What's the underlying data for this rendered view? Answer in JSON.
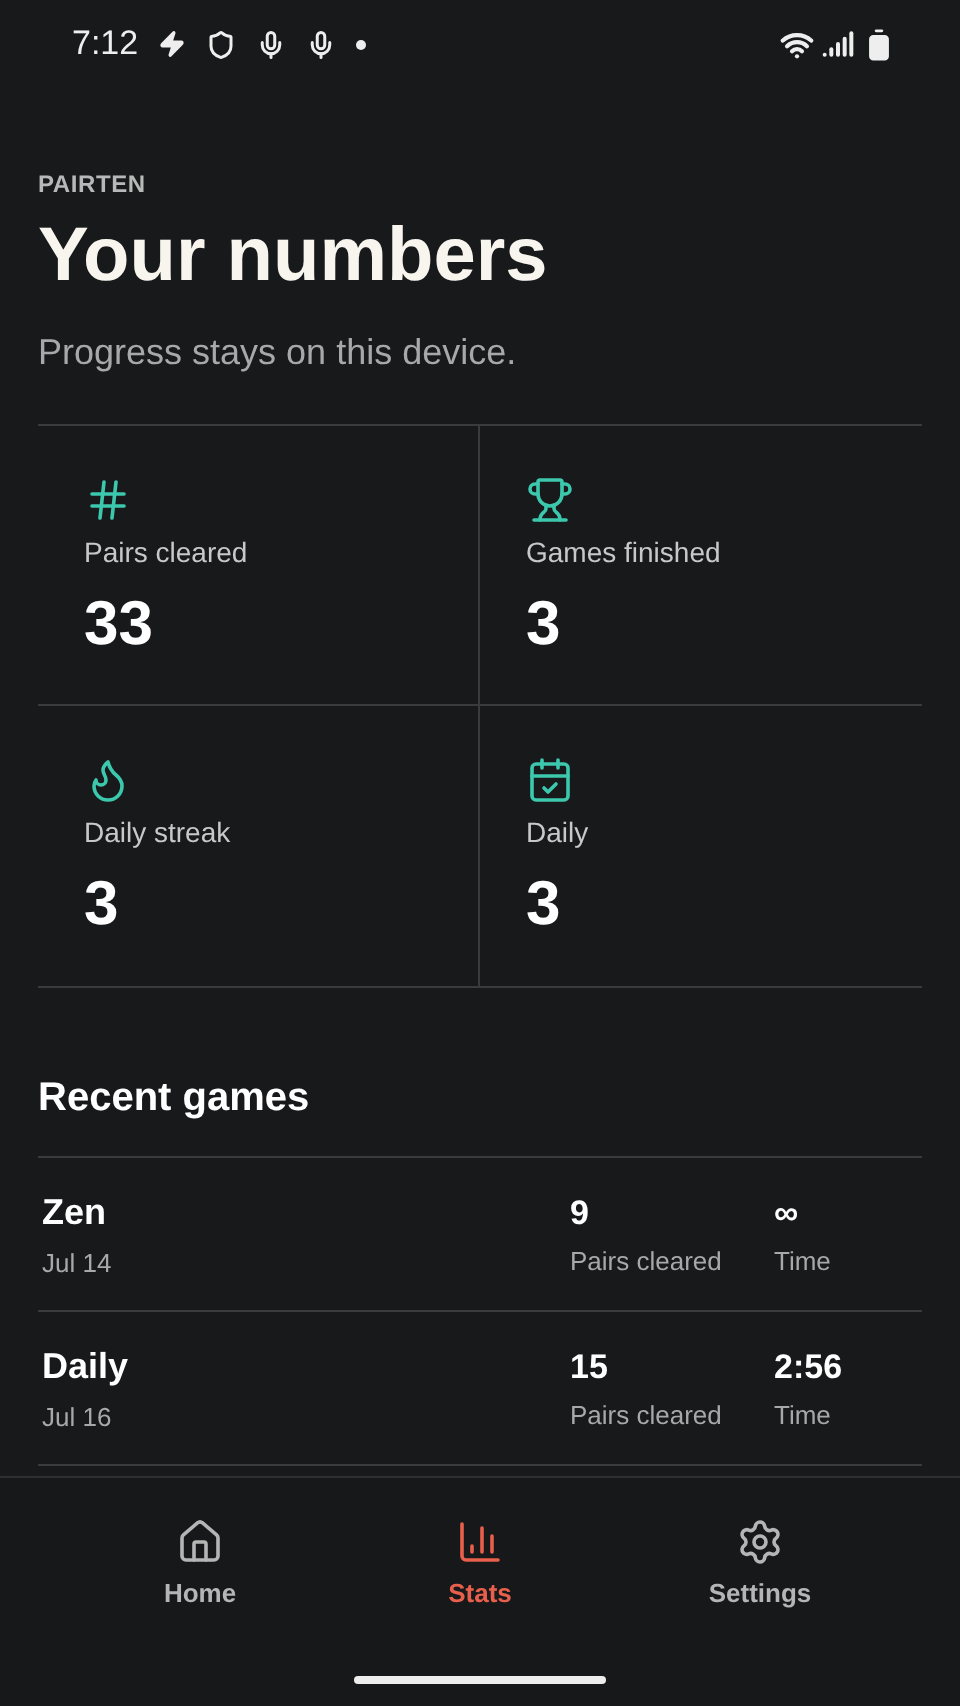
{
  "status_bar": {
    "time": "7:12"
  },
  "header": {
    "eyebrow": "PAIRTEN",
    "title": "Your numbers",
    "subtitle": "Progress stays on this device."
  },
  "stats": [
    {
      "kind": "pairs",
      "label": "Pairs cleared",
      "value": "33"
    },
    {
      "kind": "games",
      "label": "Games finished",
      "value": "3"
    },
    {
      "kind": "streak",
      "label": "Daily streak",
      "value": "3"
    },
    {
      "kind": "daily",
      "label": "Daily",
      "value": "3"
    }
  ],
  "recent": {
    "heading": "Recent games",
    "rows": [
      {
        "mode": "Zen",
        "date": "Jul 14",
        "pairs": "9",
        "pairs_label": "Pairs cleared",
        "time": "∞",
        "time_label": "Time"
      },
      {
        "mode": "Daily",
        "date": "Jul 16",
        "pairs": "15",
        "pairs_label": "Pairs cleared",
        "time": "2:56",
        "time_label": "Time"
      }
    ]
  },
  "nav": [
    {
      "kind": "home",
      "label": "Home",
      "selected": false
    },
    {
      "kind": "stats",
      "label": "Stats",
      "selected": true
    },
    {
      "kind": "settings",
      "label": "Settings",
      "selected": false
    }
  ]
}
